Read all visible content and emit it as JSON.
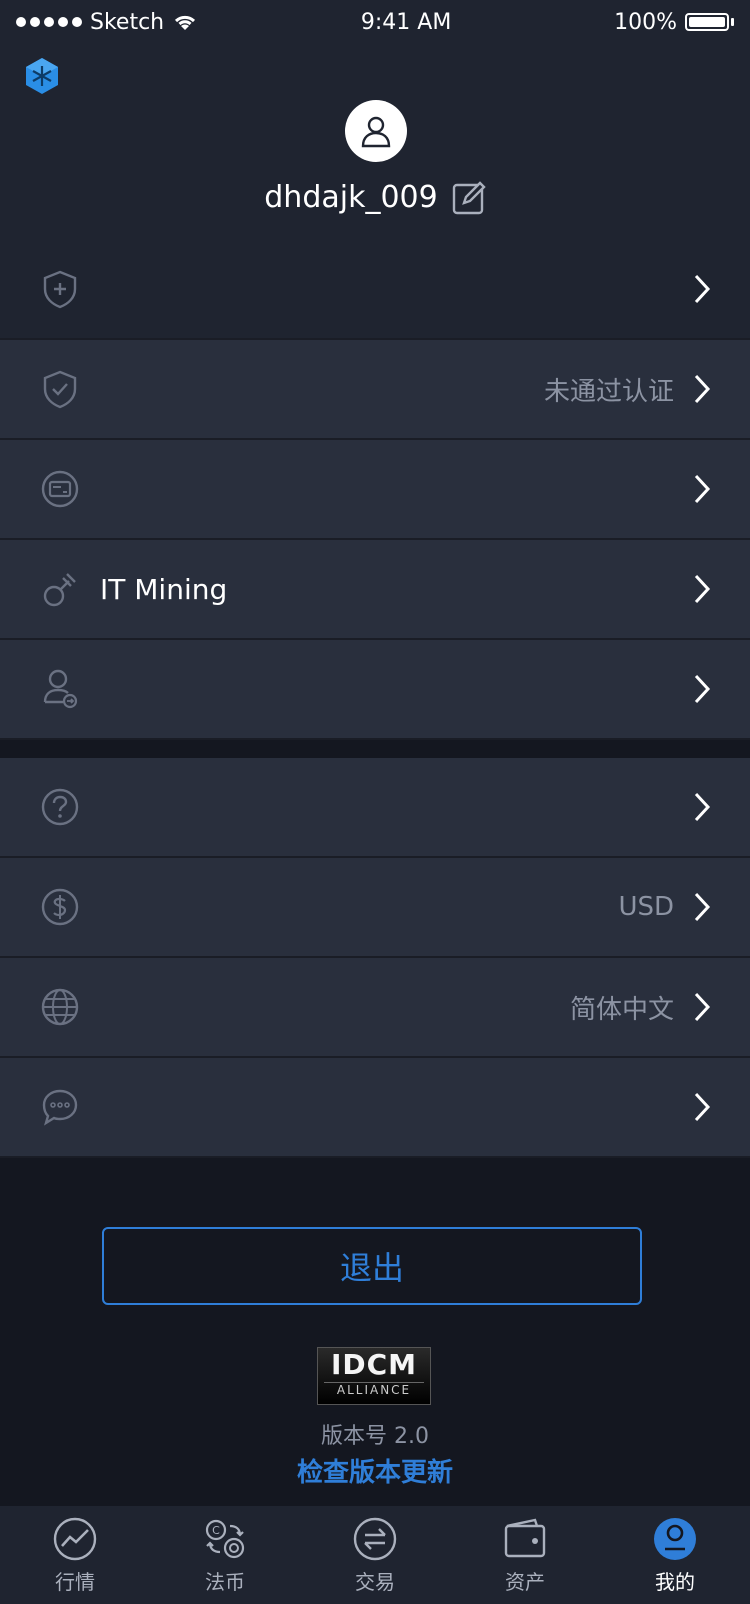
{
  "status_bar": {
    "carrier": "Sketch",
    "time": "9:41 AM",
    "battery": "100%"
  },
  "profile": {
    "username": "dhdajk_009"
  },
  "menu_group_1": [
    {
      "icon": "shield-plus-icon",
      "label": "",
      "value": ""
    },
    {
      "icon": "shield-check-icon",
      "label": "",
      "value": "未通过认证"
    },
    {
      "icon": "card-icon",
      "label": "",
      "value": ""
    },
    {
      "icon": "mining-pick-icon",
      "label": "IT Mining",
      "value": ""
    },
    {
      "icon": "user-share-icon",
      "label": "",
      "value": ""
    }
  ],
  "menu_group_2": [
    {
      "icon": "help-icon",
      "label": "",
      "value": ""
    },
    {
      "icon": "dollar-icon",
      "label": "",
      "value": "USD"
    },
    {
      "icon": "globe-icon",
      "label": "",
      "value": "简体中文"
    },
    {
      "icon": "chat-icon",
      "label": "",
      "value": ""
    }
  ],
  "logout": {
    "label": "退出"
  },
  "footer": {
    "logo_main": "IDCM",
    "logo_sub": "ALLIANCE",
    "version": "版本号 2.0",
    "check_update": "检查版本更新"
  },
  "tabbar": [
    {
      "icon": "market-icon",
      "label": "行情"
    },
    {
      "icon": "fiat-exchange-icon",
      "label": "法币"
    },
    {
      "icon": "trade-icon",
      "label": "交易"
    },
    {
      "icon": "wallet-icon",
      "label": "资产"
    },
    {
      "icon": "profile-icon",
      "label": "我的",
      "active": true
    }
  ],
  "colors": {
    "accent": "#2f7ed8",
    "background": "#141720",
    "row": "#292f3d",
    "header": "#1f2430"
  }
}
